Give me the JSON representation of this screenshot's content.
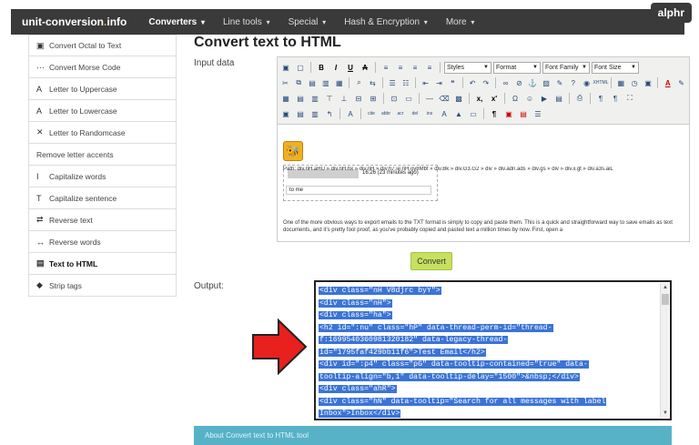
{
  "nav": {
    "brand": "unit-conversion",
    "brand_dot": ".",
    "brand_tld": "info",
    "items": [
      {
        "label": "Converters",
        "caret": "▾"
      },
      {
        "label": "Line tools",
        "caret": "▾"
      },
      {
        "label": "Special",
        "caret": "▾"
      },
      {
        "label": "Hash & Encryption",
        "caret": "▾"
      },
      {
        "label": "More",
        "caret": "▾"
      }
    ]
  },
  "watermark": "alphr",
  "sidebar": {
    "items": [
      {
        "icon": "▣",
        "label": "Convert Octal to Text"
      },
      {
        "icon": "···",
        "label": "Convert Morse Code"
      },
      {
        "icon": "A",
        "label": "Letter to Uppercase"
      },
      {
        "icon": "A",
        "label": "Letter to Lowercase"
      },
      {
        "icon": "✕",
        "label": "Letter to Randomcase"
      },
      {
        "icon": "",
        "label": "Remove letter accents"
      },
      {
        "icon": "I",
        "label": "Capitalize words"
      },
      {
        "icon": "T",
        "label": "Capitalize sentence"
      },
      {
        "icon": "⇄",
        "label": "Reverse text"
      },
      {
        "icon": "↔",
        "label": "Reverse words"
      },
      {
        "icon": "▤",
        "label": "Text to HTML"
      },
      {
        "icon": "◆",
        "label": "Strip tags"
      }
    ]
  },
  "main": {
    "title": "Convert text to HTML",
    "input_label": "Input data",
    "output_label": "Output:",
    "convert_label": "Convert"
  },
  "editor": {
    "styles": "Styles",
    "format": "Format",
    "font_family": "Font Family",
    "font_size": "Font Size",
    "timestamp": "16:26 (23 minutes ago)",
    "to_me": "to me",
    "body_text": "One of the more obvious ways to export emails to the TXT format is simply to copy and paste them. This is a quick and straightforward way to save emails as text documents, and it’s pretty fool proof, as you’ve probably copied and pasted text a million times by now. First, open a",
    "path_text": "Path: div.nH.aHU » div.nH.hx » div.nH » div.h7.ie.nH.oy8Mbf » div.Bk » div.G3.G2 » div » div.adn.ads » div.gs » div » div.ii.gt » div.a3s.aiL"
  },
  "output": {
    "lines": [
      "<div class=\"nH V8djrc byY\">",
      "<div class=\"nH\">",
      "<div class=\"ha\">",
      "<h2 id=\":nu\" class=\"hP\" data-thread-perm-id=\"thread-",
      "f:1699540360981320182\" data-legacy-thread-",
      "id=\"1795faf429bb11f6\">Test Email</h2>",
      "<div id=\":p4\" class=\"pG\" data-tooltip-contained=\"true\" data-",
      "tooltip-align=\"b,1\" data-tooltip-delay=\"1500\">&nbsp;</div>",
      "<div class=\"ahR\">",
      "<div class=\"hN\" data-tooltip=\"Search for all messages with label",
      "Inbox\">Inbox</div>"
    ]
  },
  "about_text": "About Convert text to HTML tool"
}
